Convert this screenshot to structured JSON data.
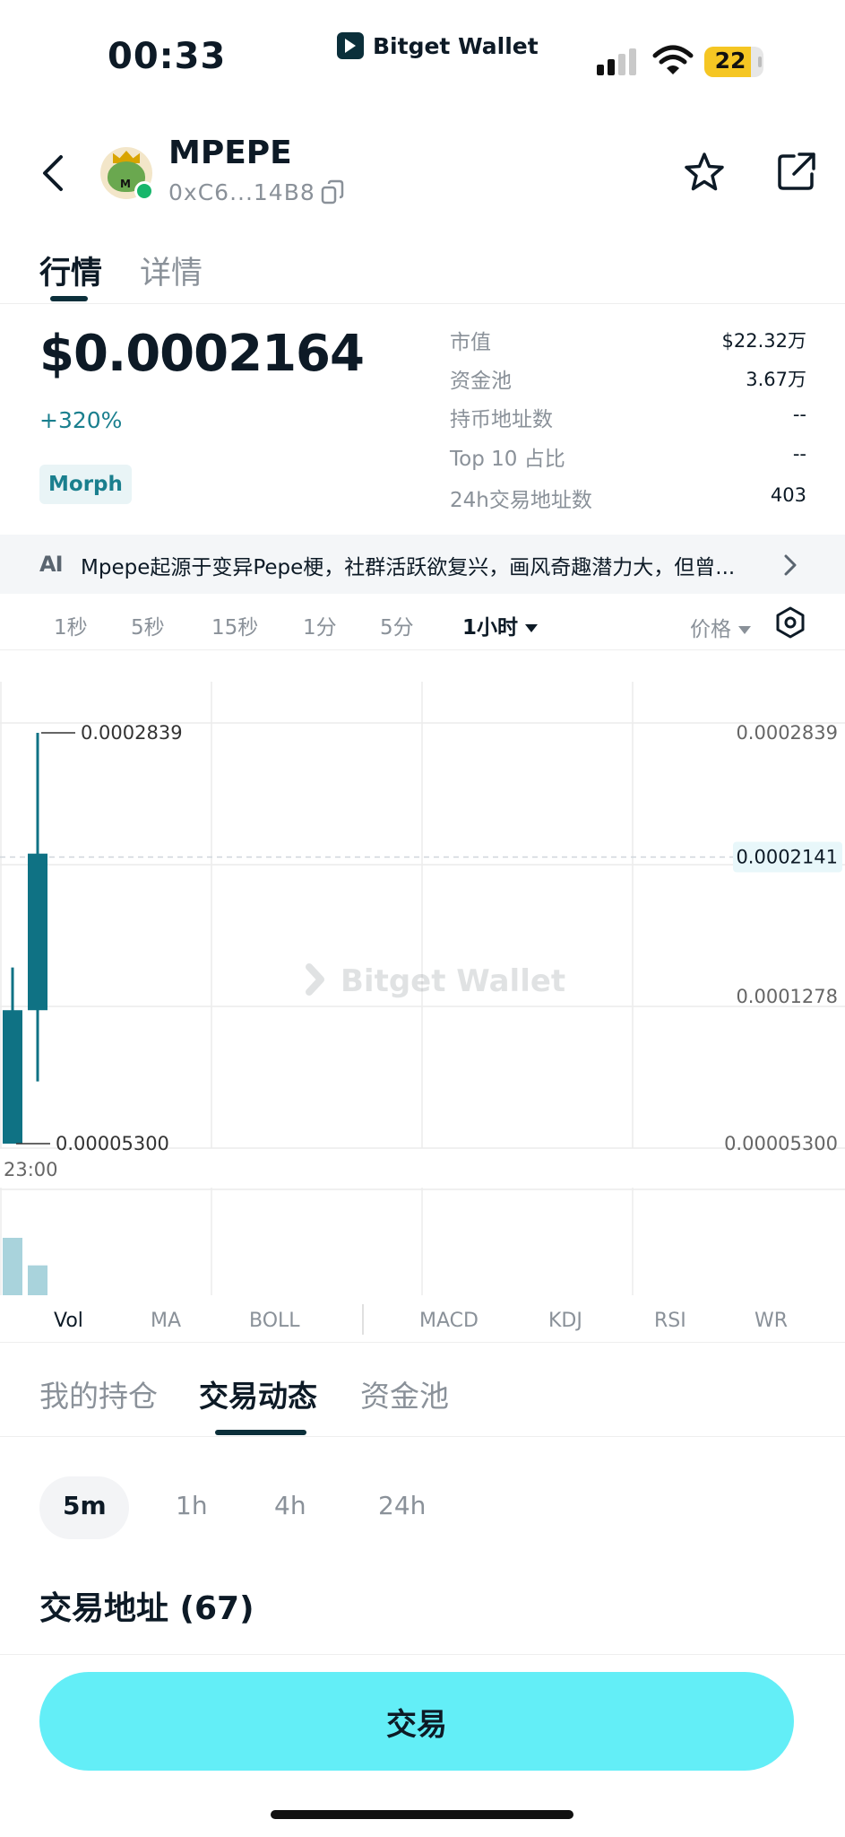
{
  "status_bar": {
    "time": "00:33",
    "battery": "22",
    "brand": "Bitget Wallet"
  },
  "token": {
    "name": "MPEPE",
    "address": "0xC6...14B8"
  },
  "tabs": {
    "market": "行情",
    "detail": "详情"
  },
  "price": {
    "value": "$0.0002164",
    "change": "+320%",
    "chain": "Morph"
  },
  "stats": [
    {
      "label": "市值",
      "value": "$22.32万"
    },
    {
      "label": "资金池",
      "value": "3.67万"
    },
    {
      "label": "持币地址数",
      "value": "--"
    },
    {
      "label": "Top 10 占比",
      "value": "--"
    },
    {
      "label": "24h交易地址数",
      "value": "403"
    }
  ],
  "ai_banner": {
    "icon": "AI",
    "text": "Mpepe起源于变异Pepe梗，社群活跃欲复兴，画风奇趣潜力大，但曾..."
  },
  "intervals": [
    "1秒",
    "5秒",
    "15秒",
    "1分",
    "5分",
    "1小时"
  ],
  "price_mode": "价格",
  "chart_data": {
    "type": "candlestick",
    "y_axis_labels": [
      "0.0002839",
      "0.0001278",
      "0.00005300"
    ],
    "current_price_label": "0.0002141",
    "high_label": "0.0002839",
    "low_label": "0.00005300",
    "x_labels": [
      "23:00"
    ],
    "watermark": "Bitget Wallet",
    "ylim": [
      5.3e-05,
      0.0002839
    ],
    "current_price": 0.0002141,
    "candles": [
      {
        "open": 0.000128,
        "close": 5.3e-05,
        "high": 0.000152,
        "low": 5.3e-05,
        "color": "#0f7284"
      },
      {
        "open": 0.000128,
        "close": 0.000216,
        "high": 0.0002839,
        "low": 8.8e-05,
        "color": "#0f7284"
      }
    ],
    "volume": [
      1.0,
      0.52
    ]
  },
  "indicators": [
    "Vol",
    "MA",
    "BOLL",
    "MACD",
    "KDJ",
    "RSI",
    "WR"
  ],
  "sub_tabs": [
    "我的持仓",
    "交易动态",
    "资金池"
  ],
  "ranges": [
    "5m",
    "1h",
    "4h",
    "24h"
  ],
  "trade_addresses": {
    "title": "交易地址 (67)"
  },
  "trade_button": "交易",
  "colors": {
    "accent": "#63eef7",
    "candle": "#0f7284",
    "positive": "#1a7f8e",
    "volume": "#a9d3dc"
  }
}
